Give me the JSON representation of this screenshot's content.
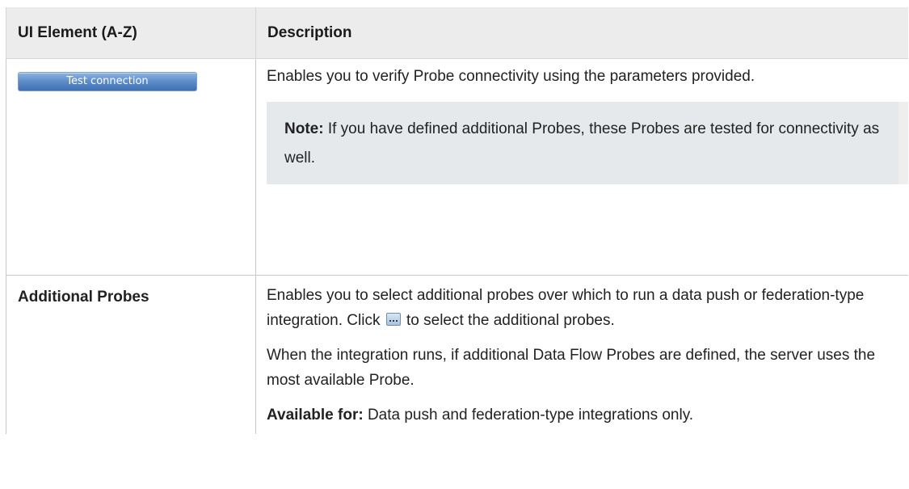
{
  "table": {
    "headers": {
      "element": "UI Element (A-Z)",
      "description": "Description"
    },
    "rows": [
      {
        "element_button_label": "Test connection",
        "description": "Enables you to verify Probe connectivity using the parameters provided.",
        "note_label": "Note:",
        "note_text": "If you have defined additional Probes, these Probes are tested for connectivity as well."
      },
      {
        "element_label": "Additional Probes",
        "description_part1": "Enables you to select additional probes over which to run a data push or federation-type integration. Click",
        "description_part2": "to select the additional probes.",
        "description2": "When the integration runs, if additional Data Flow Probes are defined, the server uses the most available Probe.",
        "available_label": "Available for:",
        "available_text": "Data push and federation-type integrations only."
      }
    ]
  },
  "icons": {
    "browse_button": "ellipsis-browse-icon"
  }
}
